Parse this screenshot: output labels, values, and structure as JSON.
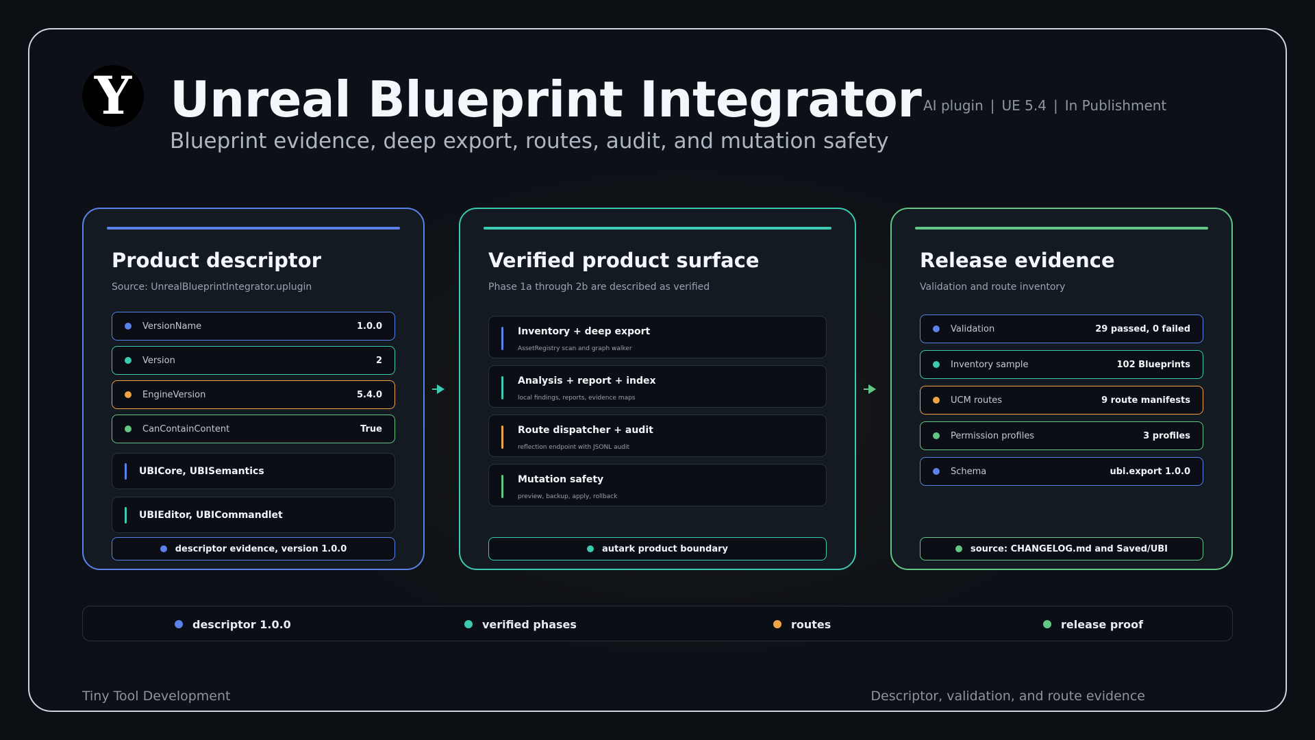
{
  "header": {
    "logo_letter": "Y",
    "title": "Unreal Blueprint Integrator",
    "subtitle": "Blueprint evidence, deep export, routes, audit, and mutation safety",
    "meta": [
      "AI plugin",
      "UE 5.4",
      "In Publishment"
    ],
    "meta_separator": "|"
  },
  "colors": {
    "blue": "#5b82e8",
    "teal": "#3ccab0",
    "orange": "#f0a446",
    "green": "#62c784",
    "background": "#0d1117"
  },
  "descriptor": {
    "title": "Product descriptor",
    "source": "Source: UnrealBlueprintIntegrator.uplugin",
    "fields": [
      {
        "key": "VersionName",
        "value": "1.0.0",
        "color": "blue"
      },
      {
        "key": "Version",
        "value": "2",
        "color": "teal"
      },
      {
        "key": "EngineVersion",
        "value": "5.4.0",
        "color": "orange"
      },
      {
        "key": "CanContainContent",
        "value": "True",
        "color": "green"
      }
    ],
    "modules": [
      {
        "label": "UBICore, UBISemantics",
        "color": "blue"
      },
      {
        "label": "UBIEditor, UBICommandlet",
        "color": "teal"
      }
    ],
    "footer": "descriptor evidence, version 1.0.0"
  },
  "surface": {
    "title": "Verified product surface",
    "subtitle": "Phase 1a through 2b are described as verified",
    "phases": [
      {
        "title": "Inventory + deep export",
        "detail": "AssetRegistry scan and graph walker",
        "color": "blue"
      },
      {
        "title": "Analysis + report + index",
        "detail": "local findings, reports, evidence maps",
        "color": "teal"
      },
      {
        "title": "Route dispatcher + audit",
        "detail": "reflection endpoint with JSONL audit",
        "color": "orange"
      },
      {
        "title": "Mutation safety",
        "detail": "preview, backup, apply, rollback",
        "color": "green"
      }
    ],
    "footer": "autark product boundary"
  },
  "release": {
    "title": "Release evidence",
    "subtitle": "Validation and route inventory",
    "items": [
      {
        "key": "Validation",
        "value": "29 passed, 0 failed",
        "color": "blue"
      },
      {
        "key": "Inventory sample",
        "value": "102 Blueprints",
        "color": "teal"
      },
      {
        "key": "UCM routes",
        "value": "9 route manifests",
        "color": "orange"
      },
      {
        "key": "Permission profiles",
        "value": "3 profiles",
        "color": "green"
      },
      {
        "key": "Schema",
        "value": "ubi.export 1.0.0",
        "color": "blue"
      }
    ],
    "footer": "source: CHANGELOG.md and Saved/UBI"
  },
  "legend": [
    {
      "label": "descriptor 1.0.0",
      "color": "blue"
    },
    {
      "label": "verified phases",
      "color": "teal"
    },
    {
      "label": "routes",
      "color": "orange"
    },
    {
      "label": "release proof",
      "color": "green"
    }
  ],
  "footer": {
    "left": "Tiny Tool Development",
    "right": "Descriptor, validation, and route evidence"
  }
}
